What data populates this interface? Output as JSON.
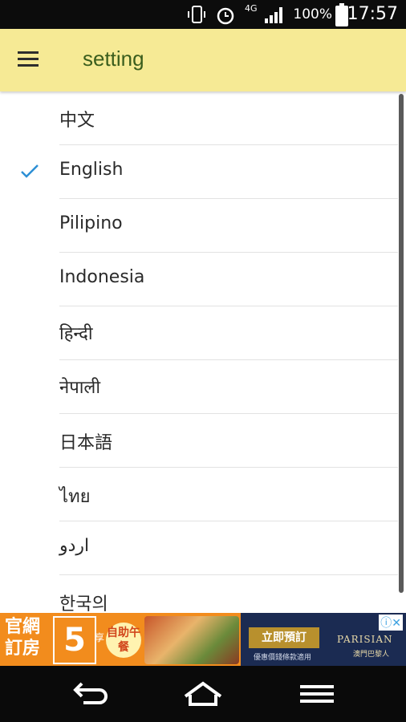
{
  "status_bar": {
    "battery_text": "100%",
    "time": "17:57",
    "network": "4G"
  },
  "app_bar": {
    "title": "setting"
  },
  "languages": [
    {
      "label": "中文",
      "selected": false
    },
    {
      "label": "English",
      "selected": true
    },
    {
      "label": "Pilipino",
      "selected": false
    },
    {
      "label": "Indonesia",
      "selected": false
    },
    {
      "label": "हिन्दी",
      "selected": false
    },
    {
      "label": "नेपाली",
      "selected": false
    },
    {
      "label": "日本語",
      "selected": false
    },
    {
      "label": "ไทย",
      "selected": false
    },
    {
      "label": "اردو",
      "selected": false
    },
    {
      "label": "한국의",
      "selected": false
    }
  ],
  "ad": {
    "left_text": "官網訂房",
    "big_number": "5",
    "small_text": "享",
    "buffet_text": "自助午餐",
    "button_text": "立即預訂",
    "sub_text": "優惠價錢條款適用",
    "brand": "PARISIAN",
    "brand_sub": "澳門巴黎人"
  },
  "colors": {
    "app_bar_bg": "#f6ea95",
    "title_color": "#3a5d1d",
    "check_color": "#2d8fd5"
  }
}
